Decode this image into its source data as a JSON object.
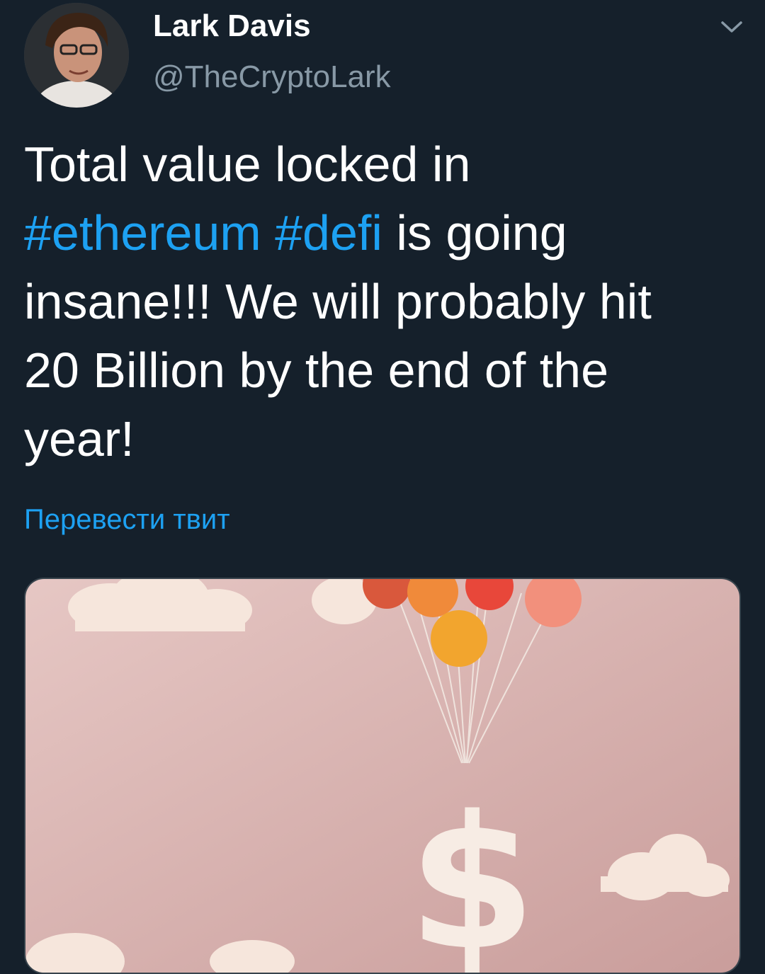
{
  "author": {
    "name": "Lark Davis",
    "handle": "@TheCryptoLark"
  },
  "tweet": {
    "lines": [
      [
        {
          "text": "Total value locked in",
          "type": "text"
        }
      ],
      [
        {
          "text": "#ethereum",
          "type": "hashtag"
        },
        {
          "text": " ",
          "type": "text"
        },
        {
          "text": "#defi",
          "type": "hashtag"
        },
        {
          "text": " is going",
          "type": "text"
        }
      ],
      [
        {
          "text": "insane!!! We will probably hit",
          "type": "text"
        }
      ],
      [
        {
          "text": "20 Billion by the end of the",
          "type": "text"
        }
      ],
      [
        {
          "text": "year!",
          "type": "text"
        }
      ]
    ],
    "translate_label": "Перевести твит"
  },
  "icons": {
    "menu": "chevron-down-icon"
  },
  "colors": {
    "background": "#15202b",
    "link": "#1da1f2",
    "secondary_text": "#8899a6",
    "media_background": "#d8b4b2"
  }
}
